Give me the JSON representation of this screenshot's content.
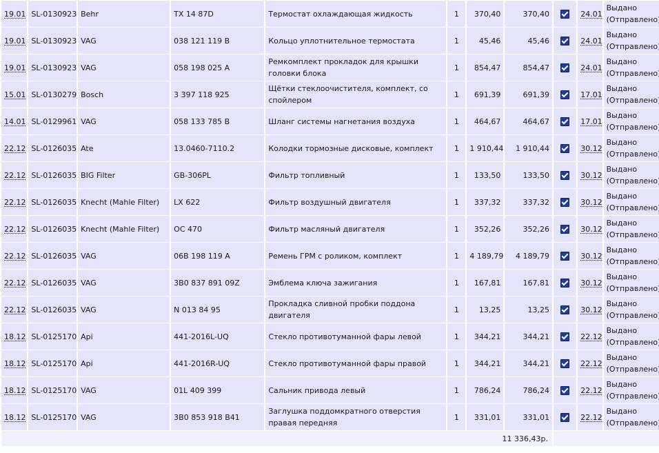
{
  "currency_suffix": "р.",
  "total": "11 336,43р.",
  "checkbox_icon": "checked-checkbox-icon",
  "rows": [
    {
      "date": "19.01",
      "order": "SL-0130923",
      "brand": "Behr",
      "article": "TX 14 87D",
      "description": "Термостат охлаждающая жидкость",
      "qty": "1",
      "price": "370,40",
      "sum": "370,40",
      "checked": true,
      "received_date": "24.01",
      "status": "Выдано (Отправлено)"
    },
    {
      "date": "19.01",
      "order": "SL-0130923",
      "brand": "VAG",
      "article": "038 121 119 B",
      "description": "Кольцо уплотнительное термостата",
      "qty": "1",
      "price": "45,46",
      "sum": "45,46",
      "checked": true,
      "received_date": "24.01",
      "status": "Выдано (Отправлено)"
    },
    {
      "date": "19.01",
      "order": "SL-0130923",
      "brand": "VAG",
      "article": "058 198 025 A",
      "description": "Ремкомплект прокладок для крышки головки блока",
      "qty": "1",
      "price": "854,47",
      "sum": "854,47",
      "checked": true,
      "received_date": "24.01",
      "status": "Выдано (Отправлено)"
    },
    {
      "date": "15.01",
      "order": "SL-0130279",
      "brand": "Bosch",
      "article": "3 397 118 925",
      "description": "Щётки стеклоочистителя, комплект, со спойлером",
      "qty": "1",
      "price": "691,39",
      "sum": "691,39",
      "checked": true,
      "received_date": "17.01",
      "status": "Выдано (Отправлено)"
    },
    {
      "date": "14.01",
      "order": "SL-0129961",
      "brand": "VAG",
      "article": "058 133 785 B",
      "description": "Шланг системы нагнетания воздуха",
      "qty": "1",
      "price": "464,67",
      "sum": "464,67",
      "checked": true,
      "received_date": "17.01",
      "status": "Выдано (Отправлено)"
    },
    {
      "date": "22.12",
      "order": "SL-0126035",
      "brand": "Ate",
      "article": "13.0460-7110.2",
      "description": "Колодки тормозные дисковые, комплект",
      "qty": "1",
      "price": "1 910,44",
      "sum": "1 910,44",
      "checked": true,
      "received_date": "30.12",
      "status": "Выдано (Отправлено)"
    },
    {
      "date": "22.12",
      "order": "SL-0126035",
      "brand": "BIG Filter",
      "article": "GB-306PL",
      "description": "Фильтр топливный",
      "qty": "1",
      "price": "133,50",
      "sum": "133,50",
      "checked": true,
      "received_date": "30.12",
      "status": "Выдано (Отправлено)"
    },
    {
      "date": "22.12",
      "order": "SL-0126035",
      "brand": "Knecht (Mahle Filter)",
      "article": "LX 622",
      "description": "Фильтр воздушный двигателя",
      "qty": "1",
      "price": "337,32",
      "sum": "337,32",
      "checked": true,
      "received_date": "30.12",
      "status": "Выдано (Отправлено)"
    },
    {
      "date": "22.12",
      "order": "SL-0126035",
      "brand": "Knecht (Mahle Filter)",
      "article": "OC 470",
      "description": "Фильтр масляный двигателя",
      "qty": "1",
      "price": "352,26",
      "sum": "352,26",
      "checked": true,
      "received_date": "30.12",
      "status": "Выдано (Отправлено)"
    },
    {
      "date": "22.12",
      "order": "SL-0126035",
      "brand": "VAG",
      "article": "06B 198 119 A",
      "description": "Ремень ГРМ с роликом, комплект",
      "qty": "1",
      "price": "4 189,79",
      "sum": "4 189,79",
      "checked": true,
      "received_date": "30.12",
      "status": "Выдано (Отправлено)"
    },
    {
      "date": "22.12",
      "order": "SL-0126035",
      "brand": "VAG",
      "article": "3B0 837 891 09Z",
      "description": "Эмблема ключа зажигания",
      "qty": "1",
      "price": "167,81",
      "sum": "167,81",
      "checked": true,
      "received_date": "30.12",
      "status": "Выдано (Отправлено)"
    },
    {
      "date": "22.12",
      "order": "SL-0126035",
      "brand": "VAG",
      "article": "N 013 84 95",
      "description": "Прокладка сливной пробки поддона двигателя",
      "qty": "1",
      "price": "13,25",
      "sum": "13,25",
      "checked": true,
      "received_date": "30.12",
      "status": "Выдано (Отправлено)"
    },
    {
      "date": "18.12",
      "order": "SL-0125170",
      "brand": "Api",
      "article": "441-2016L-UQ",
      "description": "Стекло противотуманной фары левой",
      "qty": "1",
      "price": "344,21",
      "sum": "344,21",
      "checked": true,
      "received_date": "22.12",
      "status": "Выдано (Отправлено)"
    },
    {
      "date": "18.12",
      "order": "SL-0125170",
      "brand": "Api",
      "article": "441-2016R-UQ",
      "description": "Стекло противотуманной фары правой",
      "qty": "1",
      "price": "344,21",
      "sum": "344,21",
      "checked": true,
      "received_date": "22.12",
      "status": "Выдано (Отправлено)"
    },
    {
      "date": "18.12",
      "order": "SL-0125170",
      "brand": "VAG",
      "article": "01L 409 399",
      "description": "Сальник привода левый",
      "qty": "1",
      "price": "786,24",
      "sum": "786,24",
      "checked": true,
      "received_date": "22.12",
      "status": "Выдано (Отправлено)"
    },
    {
      "date": "18.12",
      "order": "SL-0125170",
      "brand": "VAG",
      "article": "3B0 853 918 B41",
      "description": "Заглушка поддомкратного отверстия правая передняя",
      "qty": "1",
      "price": "331,01",
      "sum": "331,01",
      "checked": true,
      "received_date": "22.12",
      "status": "Выдано (Отправлено)"
    }
  ]
}
